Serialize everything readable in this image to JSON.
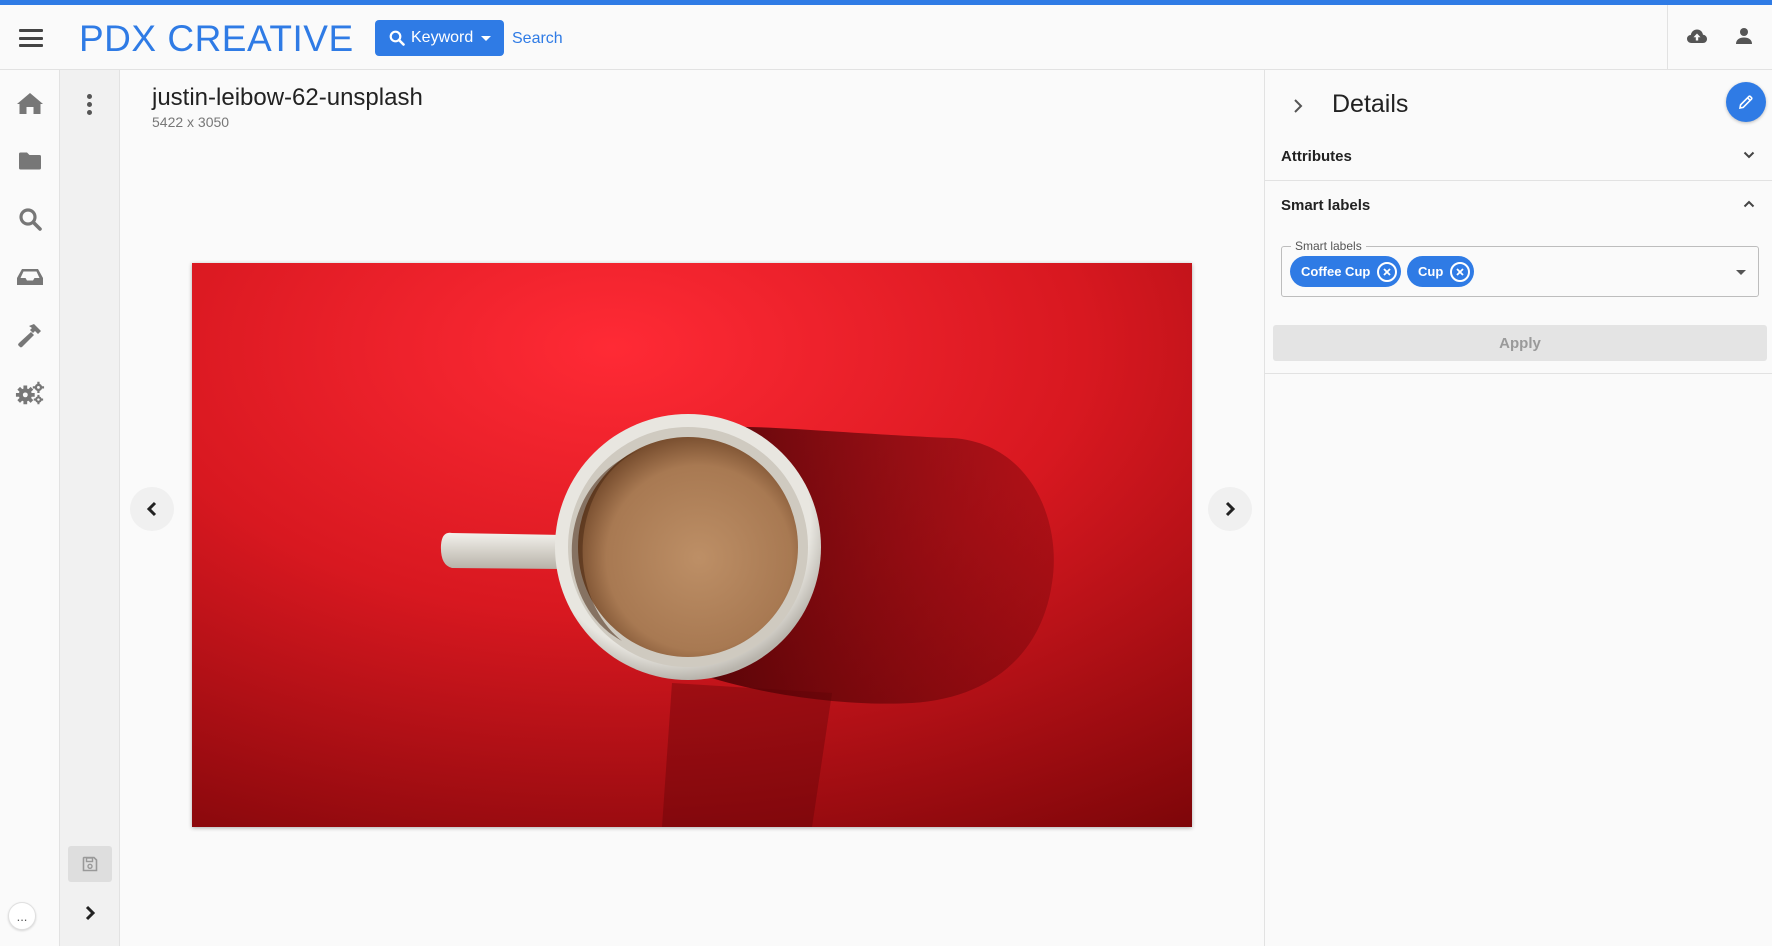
{
  "header": {
    "brand": "PDX CREATIVE",
    "search_type_label": "Keyword",
    "search_placeholder": "Search"
  },
  "nav": {
    "icons": [
      "home-icon",
      "folder-icon",
      "search-icon",
      "inbox-icon",
      "hammer-icon",
      "gears-icon"
    ],
    "more_label": "..."
  },
  "asset": {
    "title": "justin-leibow-62-unsplash",
    "dimensions": "5422 x 3050"
  },
  "details": {
    "title": "Details",
    "sections": {
      "attributes": "Attributes",
      "smart_labels": "Smart labels"
    },
    "smart_labels_field_label": "Smart labels",
    "chips": [
      "Coffee Cup",
      "Cup"
    ],
    "apply_label": "Apply"
  },
  "colors": {
    "accent": "#2f7be5",
    "photo_red": "#d61a22"
  }
}
